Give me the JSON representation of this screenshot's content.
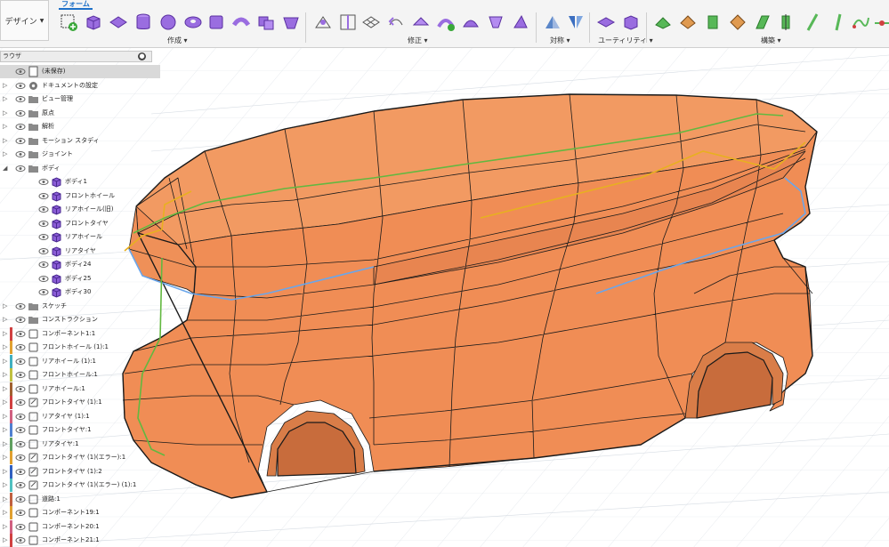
{
  "toolbar": {
    "design_label": "デザイン",
    "tab_form": "フォーム",
    "groups": {
      "create": "作成",
      "modify": "修正",
      "symmetry": "対称",
      "utilities": "ユーティリティ",
      "construct": "構築"
    }
  },
  "browser": {
    "title": "ラウザ",
    "rows": [
      {
        "name": "root",
        "label": "(未保存)",
        "indent": 0,
        "arrow": "",
        "icon": "document-icon"
      },
      {
        "name": "doc-settings",
        "label": "ドキュメントの設定",
        "indent": 0,
        "arrow": "▷",
        "icon": "gear-icon"
      },
      {
        "name": "named-views",
        "label": "ビュー管理",
        "indent": 0,
        "arrow": "▷",
        "icon": "folder-icon"
      },
      {
        "name": "origin",
        "label": "原点",
        "indent": 0,
        "arrow": "▷",
        "icon": "folder-icon"
      },
      {
        "name": "analysis",
        "label": "解析",
        "indent": 0,
        "arrow": "▷",
        "icon": "folder-icon"
      },
      {
        "name": "motion-study",
        "label": "モーション スタディ",
        "indent": 0,
        "arrow": "▷",
        "icon": "folder-icon"
      },
      {
        "name": "joints",
        "label": "ジョイント",
        "indent": 0,
        "arrow": "▷",
        "icon": "folder-icon"
      },
      {
        "name": "bodies",
        "label": "ボディ",
        "indent": 0,
        "arrow": "◢",
        "icon": "folder-icon"
      },
      {
        "name": "body1",
        "label": "ボディ1",
        "indent": 1,
        "arrow": "",
        "icon": "body-icon"
      },
      {
        "name": "front-wheel",
        "label": "フロントホイール",
        "indent": 1,
        "arrow": "",
        "icon": "body-icon"
      },
      {
        "name": "rear-wheel-old",
        "label": "リアホイール(旧)",
        "indent": 1,
        "arrow": "",
        "icon": "body-icon"
      },
      {
        "name": "front-tire",
        "label": "フロントタイヤ",
        "indent": 1,
        "arrow": "",
        "icon": "body-icon"
      },
      {
        "name": "rear-wheel",
        "label": "リアホイール",
        "indent": 1,
        "arrow": "",
        "icon": "body-icon"
      },
      {
        "name": "rear-tire",
        "label": "リアタイヤ",
        "indent": 1,
        "arrow": "",
        "icon": "body-icon"
      },
      {
        "name": "body24",
        "label": "ボディ24",
        "indent": 1,
        "arrow": "",
        "icon": "body-icon"
      },
      {
        "name": "body25",
        "label": "ボディ25",
        "indent": 1,
        "arrow": "",
        "icon": "body-icon"
      },
      {
        "name": "body30",
        "label": "ボディ30",
        "indent": 1,
        "arrow": "",
        "icon": "body-icon"
      },
      {
        "name": "sketches",
        "label": "スケッチ",
        "indent": 0,
        "arrow": "▷",
        "icon": "folder-icon"
      },
      {
        "name": "construction",
        "label": "コンストラクション",
        "indent": 0,
        "arrow": "▷",
        "icon": "folder-icon"
      },
      {
        "name": "comp1",
        "label": "コンポーネント1:1",
        "indent": 0,
        "arrow": "▷",
        "icon": "component-icon",
        "color": "#d04040"
      },
      {
        "name": "front-wheel-1",
        "label": "フロントホイール (1):1",
        "indent": 0,
        "arrow": "▷",
        "icon": "component-icon",
        "color": "#e0a030"
      },
      {
        "name": "rear-wheel-1",
        "label": "リアホイール (1):1",
        "indent": 0,
        "arrow": "▷",
        "icon": "component-icon",
        "color": "#40b0c0"
      },
      {
        "name": "front-wheel-2",
        "label": "フロントホイール:1",
        "indent": 0,
        "arrow": "▷",
        "icon": "component-icon",
        "color": "#c0c040"
      },
      {
        "name": "rear-wheel-2",
        "label": "リアホイール:1",
        "indent": 0,
        "arrow": "▷",
        "icon": "component-icon",
        "color": "#a06030"
      },
      {
        "name": "front-tire-1",
        "label": "フロントタイヤ (1):1",
        "indent": 0,
        "arrow": "▷",
        "icon": "component-link-icon",
        "color": "#d04040"
      },
      {
        "name": "rear-tire-1",
        "label": "リアタイヤ (1):1",
        "indent": 0,
        "arrow": "▷",
        "icon": "component-icon",
        "color": "#d06080"
      },
      {
        "name": "front-tire-2",
        "label": "フロントタイヤ:1",
        "indent": 0,
        "arrow": "▷",
        "icon": "component-icon",
        "color": "#5080d0"
      },
      {
        "name": "rear-tire-2",
        "label": "リアタイヤ:1",
        "indent": 0,
        "arrow": "▷",
        "icon": "component-icon",
        "color": "#60a060"
      },
      {
        "name": "front-tire-err1",
        "label": "フロントタイヤ (1)(エラー):1",
        "indent": 0,
        "arrow": "▷",
        "icon": "component-link-icon",
        "color": "#e0a030"
      },
      {
        "name": "front-tire-1-2",
        "label": "フロントタイヤ (1):2",
        "indent": 0,
        "arrow": "▷",
        "icon": "component-link-icon",
        "color": "#3060c0"
      },
      {
        "name": "front-tire-err2",
        "label": "フロントタイヤ (1)(エラー) (1):1",
        "indent": 0,
        "arrow": "▷",
        "icon": "component-link-icon",
        "color": "#50c0c0"
      },
      {
        "name": "road",
        "label": "道路:1",
        "indent": 0,
        "arrow": "▷",
        "icon": "component-icon",
        "color": "#c06040"
      },
      {
        "name": "comp19",
        "label": "コンポーネント19:1",
        "indent": 0,
        "arrow": "▷",
        "icon": "component-icon",
        "color": "#e0a030"
      },
      {
        "name": "comp20",
        "label": "コンポーネント20:1",
        "indent": 0,
        "arrow": "▷",
        "icon": "component-icon",
        "color": "#d06080"
      },
      {
        "name": "comp21",
        "label": "コンポーネント21:1",
        "indent": 0,
        "arrow": "▷",
        "icon": "component-icon",
        "color": "#d04040"
      }
    ]
  },
  "colors": {
    "body_fill": "#f0955c",
    "body_edge": "#1a1a1a",
    "accent_blue": "#1e70c8",
    "body_icon": "#8a5cd6",
    "selection_blue": "#6aa6ea",
    "selection_yellow": "#e8b020",
    "selection_green": "#62b840"
  }
}
